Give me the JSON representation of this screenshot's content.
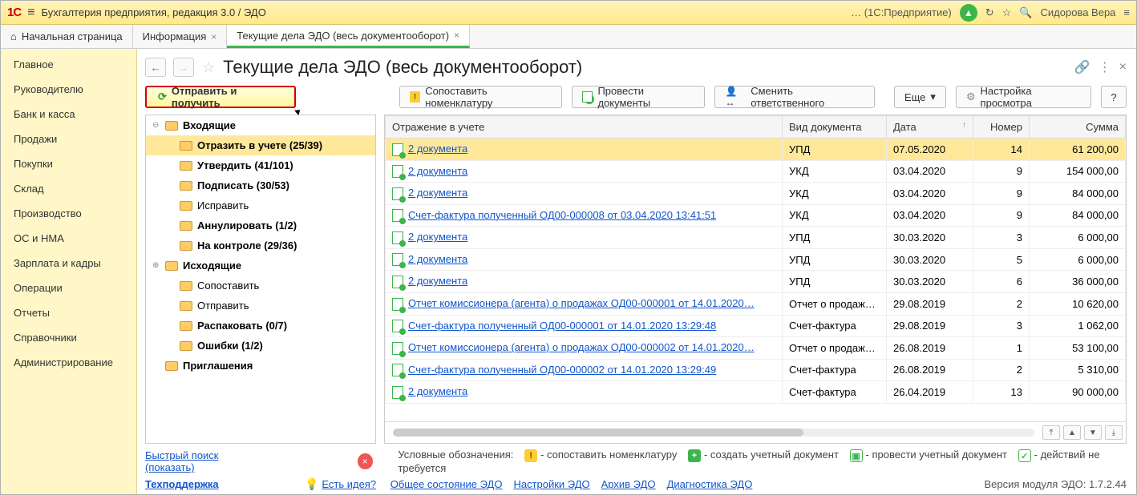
{
  "topbar": {
    "logo": "1C",
    "title": "Бухгалтерия предприятия, редакция 3.0 / ЭДО",
    "context": "…  (1С:Предприятие)",
    "user": "Сидорова Вера"
  },
  "tabs": {
    "home": "Начальная страница",
    "items": [
      {
        "label": "Информация",
        "active": false
      },
      {
        "label": "Текущие дела ЭДО (весь документооборот)",
        "active": true
      }
    ]
  },
  "leftmenu": [
    "Главное",
    "Руководителю",
    "Банк и касса",
    "Продажи",
    "Покупки",
    "Склад",
    "Производство",
    "ОС и НМА",
    "Зарплата и кадры",
    "Операции",
    "Отчеты",
    "Справочники",
    "Администрирование"
  ],
  "page": {
    "title": "Текущие дела ЭДО (весь документооборот)"
  },
  "toolbar": {
    "send_recv": "Отправить и получить",
    "match": "Сопоставить номенклатуру",
    "post": "Провести документы",
    "responsible": "Сменить ответственного",
    "more": "Еще",
    "viewsettings": "Настройка просмотра",
    "help": "?"
  },
  "tree": [
    {
      "lvl": 0,
      "exp": "⊖",
      "label": "Входящие",
      "bold": true
    },
    {
      "lvl": 1,
      "label": "Отразить в учете (25/39)",
      "selected": true,
      "bold": true
    },
    {
      "lvl": 1,
      "label": "Утвердить (41/101)",
      "bold": true
    },
    {
      "lvl": 1,
      "label": "Подписать (30/53)",
      "bold": true
    },
    {
      "lvl": 1,
      "label": "Исправить"
    },
    {
      "lvl": 1,
      "label": "Аннулировать (1/2)",
      "bold": true
    },
    {
      "lvl": 1,
      "label": "На контроле (29/36)",
      "bold": true
    },
    {
      "lvl": 0,
      "exp": "⊕",
      "label": "Исходящие",
      "bold": true
    },
    {
      "lvl": 1,
      "label": "Сопоставить"
    },
    {
      "lvl": 1,
      "label": "Отправить"
    },
    {
      "lvl": 1,
      "label": "Распаковать (0/7)",
      "bold": true
    },
    {
      "lvl": 1,
      "label": "Ошибки (1/2)",
      "bold": true
    },
    {
      "lvl": 0,
      "label": "Приглашения",
      "bold": true
    }
  ],
  "columns": {
    "ref": "Отражение в учете",
    "type": "Вид документа",
    "date": "Дата",
    "num": "Номер",
    "sum": "Сумма"
  },
  "rows": [
    {
      "ref": "2 документа",
      "type": "УПД",
      "date": "07.05.2020",
      "num": "14",
      "sum": "61 200,00",
      "sel": true
    },
    {
      "ref": "2 документа",
      "type": "УКД",
      "date": "03.04.2020",
      "num": "9",
      "sum": "154 000,00"
    },
    {
      "ref": "2 документа",
      "type": "УКД",
      "date": "03.04.2020",
      "num": "9",
      "sum": "84 000,00"
    },
    {
      "ref": "Счет-фактура полученный ОД00-000008 от 03.04.2020 13:41:51",
      "type": "УКД",
      "date": "03.04.2020",
      "num": "9",
      "sum": "84 000,00"
    },
    {
      "ref": "2 документа",
      "type": "УПД",
      "date": "30.03.2020",
      "num": "3",
      "sum": "6 000,00"
    },
    {
      "ref": "2 документа",
      "type": "УПД",
      "date": "30.03.2020",
      "num": "5",
      "sum": "6 000,00"
    },
    {
      "ref": "2 документа",
      "type": "УПД",
      "date": "30.03.2020",
      "num": "6",
      "sum": "36 000,00"
    },
    {
      "ref": "Отчет комиссионера (агента) о продажах ОД00-000001 от 14.01.2020…",
      "type": "Отчет о продажах…",
      "date": "29.08.2019",
      "num": "2",
      "sum": "10 620,00"
    },
    {
      "ref": "Счет-фактура полученный ОД00-000001 от 14.01.2020 13:29:48",
      "type": "Счет-фактура",
      "date": "29.08.2019",
      "num": "3",
      "sum": "1 062,00"
    },
    {
      "ref": "Отчет комиссионера (агента) о продажах ОД00-000002 от 14.01.2020…",
      "type": "Отчет о продажах…",
      "date": "26.08.2019",
      "num": "1",
      "sum": "53 100,00"
    },
    {
      "ref": "Счет-фактура полученный ОД00-000002 от 14.01.2020 13:29:49",
      "type": "Счет-фактура",
      "date": "26.08.2019",
      "num": "2",
      "sum": "5 310,00"
    },
    {
      "ref": "2 документа",
      "type": "Счет-фактура",
      "date": "26.04.2019",
      "num": "13",
      "sum": "90 000,00"
    }
  ],
  "bottom": {
    "quicksearch": "Быстрый поиск (показать)",
    "legend_label": "Условные обозначения:",
    "leg_warn": "- сопоставить номенклатуру",
    "leg_plus": "- создать учетный документ",
    "leg_doc": "- провести учетный документ",
    "leg_check": "- действий не требуется",
    "support": "Техподдержка",
    "idea": "Есть идея?",
    "links": [
      "Общее состояние ЭДО",
      "Настройки ЭДО",
      "Архив ЭДО",
      "Диагностика ЭДО"
    ],
    "version": "Версия модуля ЭДО: 1.7.2.44"
  }
}
